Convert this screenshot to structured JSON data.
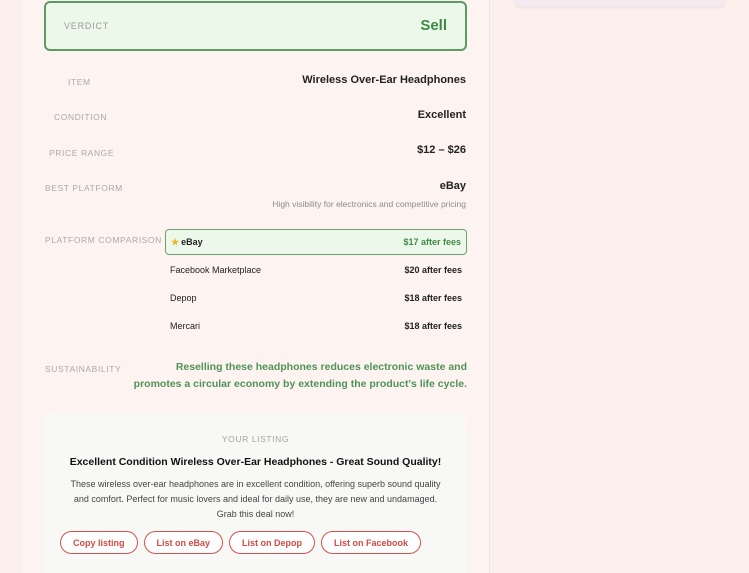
{
  "verdict": {
    "label": "VERDICT",
    "value": "Sell"
  },
  "details": {
    "item": {
      "label": "ITEM",
      "value": "Wireless Over-Ear Headphones"
    },
    "condition": {
      "label": "CONDITION",
      "value": "Excellent"
    },
    "price_range": {
      "label": "PRICE RANGE",
      "value": "$12 – $26"
    },
    "best_platform": {
      "label": "BEST PLATFORM",
      "value": "eBay",
      "note": "High visibility for electronics and competitive pricing"
    }
  },
  "platform_comparison": {
    "label": "PLATFORM COMPARISON",
    "rows": [
      {
        "name": "eBay",
        "price": "$17 after fees",
        "best": true,
        "icon": "star-icon"
      },
      {
        "name": "Facebook Marketplace",
        "price": "$20 after fees"
      },
      {
        "name": "Depop",
        "price": "$18 after fees"
      },
      {
        "name": "Mercari",
        "price": "$18 after fees"
      }
    ]
  },
  "sustainability": {
    "label": "SUSTAINABILITY",
    "text": "Reselling these headphones reduces electronic waste and promotes a circular economy by extending the product's life cycle."
  },
  "listing": {
    "label": "YOUR LISTING",
    "title": "Excellent Condition Wireless Over-Ear Headphones - Great Sound Quality!",
    "body": "These wireless over-ear headphones are in excellent condition, offering superb sound quality and comfort. Perfect for music lovers and ideal for daily use, they are new and undamaged. Grab this deal now!",
    "buttons": {
      "copy": "Copy listing",
      "ebay": "List on eBay",
      "depop": "List on Depop",
      "facebook": "List on Facebook"
    }
  },
  "colors": {
    "accent_green": "#3f8a48",
    "accent_red": "#d34a43",
    "background": "#fcefec"
  }
}
